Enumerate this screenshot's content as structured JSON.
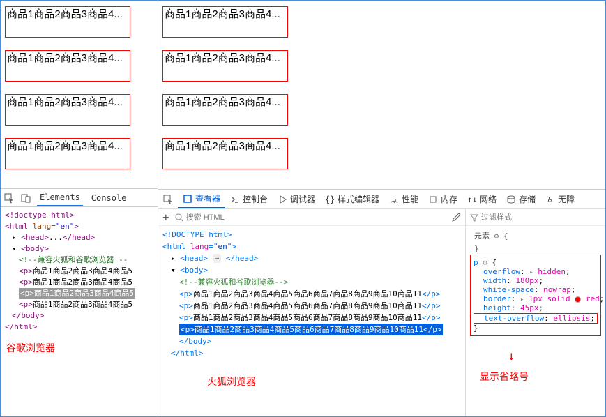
{
  "product_text": "商品1商品2商品3商品4商品5商品6商品7商品8商品9商品10商品11",
  "truncated_left": "商品1商品2商品3商品4...",
  "truncated_right": "商品1商品2商品3商品4...",
  "chrome": {
    "tabs": {
      "elements": "Elements",
      "console": "Console"
    },
    "dom": {
      "doctype": "<!doctype html>",
      "html_open": "<html lang=\"en\">",
      "head": "<head>...</head>",
      "body_open": "<body>",
      "comment": "<!--兼容火狐和谷歌浏览器 --",
      "p_line": "<p>商品1商品2商品3商品4商品5",
      "p_sel": "<p>商品1商品2商品3商品4商品5",
      "body_close": "</body>",
      "html_close": "</html>"
    },
    "label": "谷歌浏览器"
  },
  "ff": {
    "tabs": {
      "inspector": "查看器",
      "console": "控制台",
      "debugger": "调试器",
      "style": "样式编辑器",
      "perf": "性能",
      "memory": "内存",
      "network": "网络",
      "storage": "存储",
      "accessibility": "无障"
    },
    "search_placeholder": "搜索 HTML",
    "filter_placeholder": "过滤样式",
    "element_label": "元素",
    "dom": {
      "doctype": "<!DOCTYPE html>",
      "html_open": "<html lang=\"en\">",
      "head_open": "<head>",
      "head_close": "</head>",
      "body_open": "<body>",
      "comment": "<!--兼容火狐和谷歌浏览器-->",
      "p_full": "<p>商品1商品2商品3商品4商品5商品6商品7商品8商品9商品10商品11</p>",
      "body_close": "</body>",
      "html_close": "</html>"
    },
    "rule": {
      "selector": "p",
      "brace_open": "{",
      "overflow": {
        "prop": "overflow",
        "val": "hidden"
      },
      "width": {
        "prop": "width",
        "val": "180px"
      },
      "whitespace": {
        "prop": "white-space",
        "val": "nowrap"
      },
      "border": {
        "prop": "border",
        "val": "1px solid",
        "color": "red"
      },
      "height": {
        "prop": "height",
        "val": "45px"
      },
      "textoverflow": {
        "prop": "text-overflow",
        "val": "ellipsis"
      },
      "brace_close": "}"
    },
    "label": "火狐浏览器",
    "annotation": "显示省略号"
  }
}
